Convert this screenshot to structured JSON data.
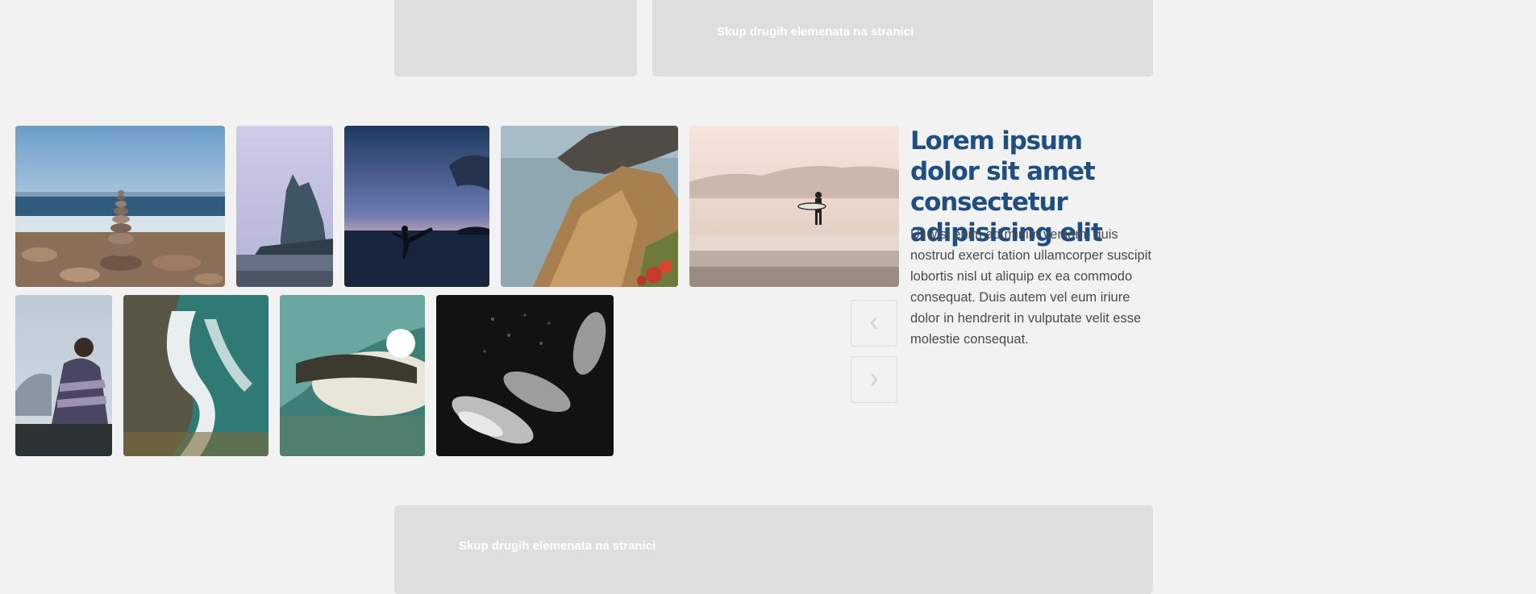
{
  "placeholders": {
    "top_right_label": "Skup drugih elemenata na stranici",
    "bottom_label": "Skup drugih elemenata na stranici"
  },
  "gallery": {
    "photos": [
      {
        "name": "stacked-stones-photo"
      },
      {
        "name": "misty-island-trees-photo"
      },
      {
        "name": "beach-kick-silhouette-photo"
      },
      {
        "name": "coastal-cliff-photo"
      },
      {
        "name": "surfer-on-beach-photo"
      },
      {
        "name": "woman-in-blanket-photo"
      },
      {
        "name": "wave-shore-aerial-photo"
      },
      {
        "name": "wave-barrel-photo"
      },
      {
        "name": "penguins-underwater-photo"
      }
    ],
    "prev_icon": "chevron-left-icon",
    "next_icon": "chevron-right-icon"
  },
  "article": {
    "title": "Lorem ipsum dolor sit amet consectetur adipisicing elit",
    "body": "Ut wisi enim ad minim veniam, quis nostrud exerci tation ullamcorper suscipit lobortis nisl ut aliquip ex ea commodo consequat. Duis autem vel eum iriure dolor in hendrerit in vulputate velit esse molestie consequat."
  },
  "colors": {
    "background": "#f2f2f2",
    "placeholder": "#dedede",
    "title": "#1f4e83",
    "text": "#4a4a4a"
  }
}
